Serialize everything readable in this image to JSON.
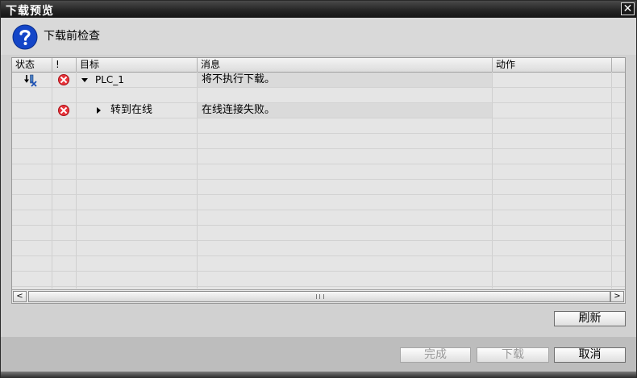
{
  "window": {
    "title": "下载预览",
    "close_glyph": "✕"
  },
  "header": {
    "text": "下载前检查",
    "icon": "question-icon"
  },
  "table": {
    "columns": [
      "状态",
      "!",
      "目标",
      "消息",
      "动作"
    ],
    "rows": [
      {
        "status_icon": "download-error-icon",
        "severity_icon": "error-icon",
        "expand": "expanded",
        "target": "PLC_1",
        "message": "将不执行下载。",
        "action": ""
      },
      {
        "status_icon": "",
        "severity_icon": "",
        "expand": "",
        "target": "",
        "message": "",
        "action": ""
      },
      {
        "status_icon": "",
        "severity_icon": "error-icon",
        "expand": "collapsed",
        "target": "转到在线",
        "message": "在线连接失败。",
        "action": ""
      }
    ],
    "scroll": {
      "left_glyph": "<",
      "right_glyph": ">",
      "grip_glyph": "III"
    }
  },
  "buttons": {
    "refresh": "刷新",
    "finish": "完成",
    "download": "下载",
    "cancel": "取消"
  },
  "colors": {
    "error": "#e8333a",
    "question_icon": "#1446c8"
  }
}
